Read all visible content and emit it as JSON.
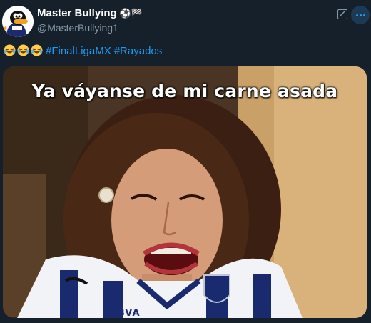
{
  "author": {
    "display_name": "Master Bullying",
    "name_emojis": "⚽🏁",
    "handle": "@MasterBullying1",
    "avatar_icon": "daffy-duck-avatar"
  },
  "header_actions": {
    "edit_icon": "edit-icon",
    "more_icon": "more-icon"
  },
  "tweet": {
    "emojis": [
      "face-with-tears-of-joy",
      "face-with-tears-of-joy",
      "face-with-tears-of-joy"
    ],
    "hashtags": [
      "#FinalLigaMX",
      "#Rayados"
    ]
  },
  "media": {
    "caption": "Ya váyanse de mi carne asada",
    "jersey_text": "BBVA"
  },
  "colors": {
    "background": "#15202b",
    "accent": "#1d9bf0",
    "secondary_text": "#8899a6"
  }
}
